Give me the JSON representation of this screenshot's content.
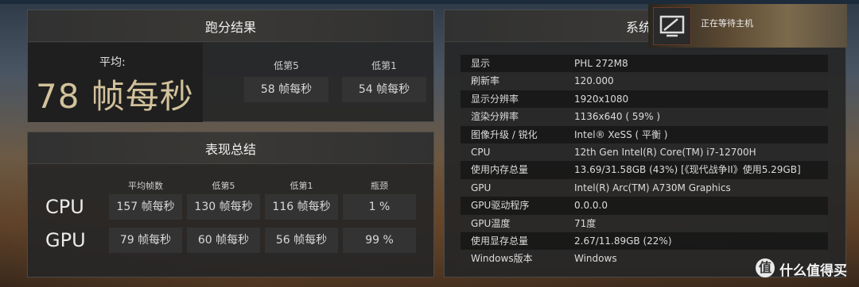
{
  "score": {
    "title": "跑分结果",
    "avg_label": "平均:",
    "avg_value": "78 帧每秒",
    "low5_label": "低第5",
    "low5_value": "58 帧每秒",
    "low1_label": "低第1",
    "low1_value": "54 帧每秒"
  },
  "summary": {
    "title": "表现总结",
    "headers": [
      "平均帧数",
      "低第5",
      "低第1",
      "瓶颈"
    ],
    "rows": [
      {
        "label": "CPU",
        "values": [
          "157 帧每秒",
          "130 帧每秒",
          "116 帧每秒",
          "1 %"
        ]
      },
      {
        "label": "GPU",
        "values": [
          "79 帧每秒",
          "60 帧每秒",
          "56 帧每秒",
          "99 %"
        ]
      }
    ]
  },
  "system": {
    "title": "系统信",
    "rows": [
      {
        "key": "显示",
        "value": "PHL 272M8"
      },
      {
        "key": "刷新率",
        "value": "120.000"
      },
      {
        "key": "显示分辨率",
        "value": "1920x1080"
      },
      {
        "key": "渲染分辨率",
        "value": "1136x640 ( 59% )"
      },
      {
        "key": "图像升级 / 锐化",
        "value": "Intel® XeSS ( 平衡 )"
      },
      {
        "key": "CPU",
        "value": "12th Gen Intel(R) Core(TM) i7-12700H"
      },
      {
        "key": "使用内存总量",
        "value": "13.69/31.58GB (43%) [《现代战争II》使用5.29GB]"
      },
      {
        "key": "GPU",
        "value": "Intel(R) Arc(TM) A730M Graphics"
      },
      {
        "key": "GPU驱动程序",
        "value": "0.0.0.0"
      },
      {
        "key": "GPU温度",
        "value": "71度"
      },
      {
        "key": "使用显存总量",
        "value": "2.67/11.89GB (22%)"
      },
      {
        "key": "Windows版本",
        "value": "Windows"
      }
    ]
  },
  "overlay": {
    "text": "正在等待主机",
    "icon": "tv-icon"
  },
  "watermark": {
    "symbol": "值",
    "text": "什么值得买"
  },
  "colors": {
    "avg_value": "#d2c29b",
    "panel_bg": "#262626",
    "topbar": "#1d2a3a"
  }
}
